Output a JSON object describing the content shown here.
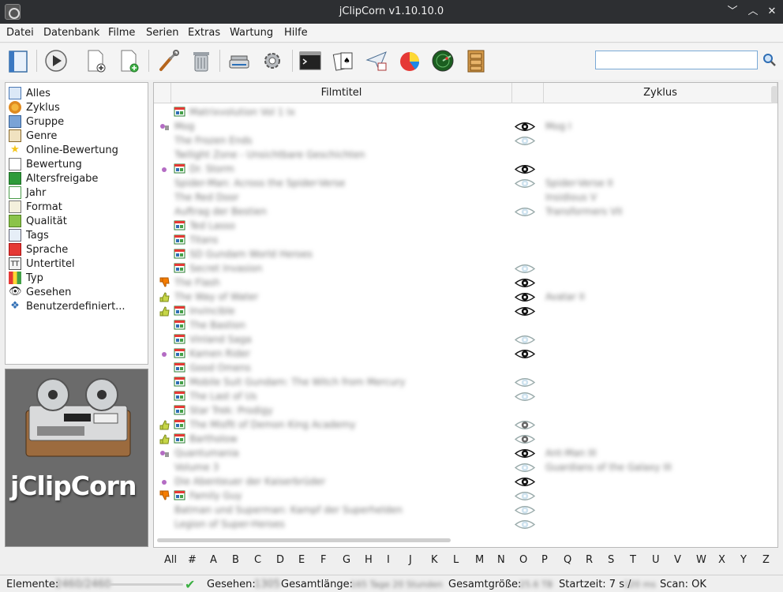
{
  "window": {
    "title": "jClipCorn v1.10.10.0",
    "controls": [
      "﹀",
      "︿",
      "✕"
    ]
  },
  "menu": [
    "Datei",
    "Datenbank",
    "Filme",
    "Serien",
    "Extras",
    "Wartung",
    "Hilfe"
  ],
  "toolbar": {
    "buttons": [
      "open-database-icon",
      "play-icon",
      "add-movie-icon",
      "add-series-icon",
      "tools-icon",
      "trash-icon",
      "scanner-icon",
      "settings-gear-icon",
      "terminal-icon",
      "cards-icon",
      "send-icon",
      "statistics-pie-icon",
      "radar-icon",
      "cabinet-icon"
    ]
  },
  "search": {
    "value": "",
    "placeholder": ""
  },
  "sidebar": {
    "items": [
      {
        "label": "Alles",
        "icon": "all-icon"
      },
      {
        "label": "Zyklus",
        "icon": "cycle-icon"
      },
      {
        "label": "Gruppe",
        "icon": "group-icon"
      },
      {
        "label": "Genre",
        "icon": "genre-icon"
      },
      {
        "label": "Online-Bewertung",
        "icon": "star-icon"
      },
      {
        "label": "Bewertung",
        "icon": "rating-icon"
      },
      {
        "label": "Altersfreigabe",
        "icon": "fsk-icon"
      },
      {
        "label": "Jahr",
        "icon": "calendar-icon"
      },
      {
        "label": "Format",
        "icon": "format-icon"
      },
      {
        "label": "Qualität",
        "icon": "quality-icon"
      },
      {
        "label": "Tags",
        "icon": "tags-icon"
      },
      {
        "label": "Sprache",
        "icon": "flag-icon"
      },
      {
        "label": "Untertitel",
        "icon": "subtitle-icon"
      },
      {
        "label": "Typ",
        "icon": "type-icon"
      },
      {
        "label": "Gesehen",
        "icon": "eye-icon"
      },
      {
        "label": "Benutzerdefiniert...",
        "icon": "custom-icon"
      }
    ]
  },
  "logo": {
    "text": "jClipCorn"
  },
  "table": {
    "columns": [
      "Filmtitel",
      "Zyklus"
    ],
    "rows": [
      {
        "tag": "",
        "icon": true,
        "title": "Matrixvolution Vol 1 Ix",
        "eye": "",
        "zyklus": ""
      },
      {
        "tag": "lock",
        "icon": false,
        "title": "Mog",
        "eye": "black",
        "zyklus": "Mog I"
      },
      {
        "tag": "",
        "icon": false,
        "title": "The Frozen Ends",
        "eye": "light",
        "zyklus": ""
      },
      {
        "tag": "",
        "icon": false,
        "title": "Twilight Zone - Unsichtbare Geschichten",
        "eye": "",
        "zyklus": ""
      },
      {
        "tag": "dot",
        "icon": true,
        "title": "Dr. Storm",
        "eye": "black",
        "zyklus": ""
      },
      {
        "tag": "",
        "icon": false,
        "title": "Spider-Man: Across the Spider-Verse",
        "eye": "light",
        "zyklus": "Spider-Verse II"
      },
      {
        "tag": "",
        "icon": false,
        "title": "The Red Door",
        "eye": "",
        "zyklus": "Insidious V"
      },
      {
        "tag": "",
        "icon": false,
        "title": "Auftrag der Bestien",
        "eye": "light",
        "zyklus": "Transformers VII"
      },
      {
        "tag": "",
        "icon": true,
        "title": "Ted Lasso",
        "eye": "",
        "zyklus": ""
      },
      {
        "tag": "",
        "icon": true,
        "title": "Titans",
        "eye": "",
        "zyklus": ""
      },
      {
        "tag": "",
        "icon": true,
        "title": "SD Gundam World Heroes",
        "eye": "",
        "zyklus": ""
      },
      {
        "tag": "",
        "icon": true,
        "title": "Secret Invasion",
        "eye": "light",
        "zyklus": ""
      },
      {
        "tag": "down",
        "icon": false,
        "title": "The Flash",
        "eye": "black",
        "zyklus": ""
      },
      {
        "tag": "up",
        "icon": false,
        "title": "The Way of Water",
        "eye": "black",
        "zyklus": "Avatar II"
      },
      {
        "tag": "up",
        "icon": true,
        "title": "Invincible",
        "eye": "black",
        "zyklus": ""
      },
      {
        "tag": "",
        "icon": true,
        "title": "The Bastion",
        "eye": "",
        "zyklus": ""
      },
      {
        "tag": "",
        "icon": true,
        "title": "Vinland Saga",
        "eye": "light",
        "zyklus": ""
      },
      {
        "tag": "dot",
        "icon": true,
        "title": "Kamen Rider",
        "eye": "black",
        "zyklus": ""
      },
      {
        "tag": "",
        "icon": true,
        "title": "Good Omens",
        "eye": "",
        "zyklus": ""
      },
      {
        "tag": "",
        "icon": true,
        "title": "Mobile Suit Gundam: The Witch from Mercury",
        "eye": "light",
        "zyklus": ""
      },
      {
        "tag": "",
        "icon": true,
        "title": "The Last of Us",
        "eye": "light",
        "zyklus": ""
      },
      {
        "tag": "",
        "icon": true,
        "title": "Star Trek: Prodigy",
        "eye": "",
        "zyklus": ""
      },
      {
        "tag": "up",
        "icon": true,
        "title": "The Misfit of Demon King Academy",
        "eye": "half",
        "zyklus": ""
      },
      {
        "tag": "up",
        "icon": true,
        "title": "Bartholow",
        "eye": "half",
        "zyklus": ""
      },
      {
        "tag": "lock",
        "icon": false,
        "title": "Quantumania",
        "eye": "black",
        "zyklus": "Ant-Man III"
      },
      {
        "tag": "",
        "icon": false,
        "title": "Volume 3",
        "eye": "light",
        "zyklus": "Guardians of the Galaxy III"
      },
      {
        "tag": "dot",
        "icon": false,
        "title": "Die Abenteuer der Kaiserbrüder",
        "eye": "black",
        "zyklus": ""
      },
      {
        "tag": "down",
        "icon": true,
        "title": "Family Guy",
        "eye": "light",
        "zyklus": ""
      },
      {
        "tag": "",
        "icon": false,
        "title": "Batman und Superman: Kampf der Superhelden",
        "eye": "light",
        "zyklus": ""
      },
      {
        "tag": "",
        "icon": false,
        "title": "Legion of Super-Heroes",
        "eye": "light",
        "zyklus": ""
      }
    ]
  },
  "alphabet": [
    "All",
    "#",
    "A",
    "B",
    "C",
    "D",
    "E",
    "F",
    "G",
    "H",
    "I",
    "J",
    "K",
    "L",
    "M",
    "N",
    "O",
    "P",
    "Q",
    "R",
    "S",
    "T",
    "U",
    "V",
    "W",
    "X",
    "Y",
    "Z"
  ],
  "status": {
    "elements_label": "Elemente:",
    "elements_value": "2460/2460",
    "seen_label": "Gesehen:",
    "seen_value": "1305",
    "length_label": "Gesamtlänge:",
    "length_value": "165 Tage 20 Stunden",
    "size_label": "Gesamtgröße:",
    "size_value": "25.6 TB",
    "start_label": "Startzeit: 7 s /",
    "start_value": "120 ms",
    "scan": "Scan: OK"
  }
}
